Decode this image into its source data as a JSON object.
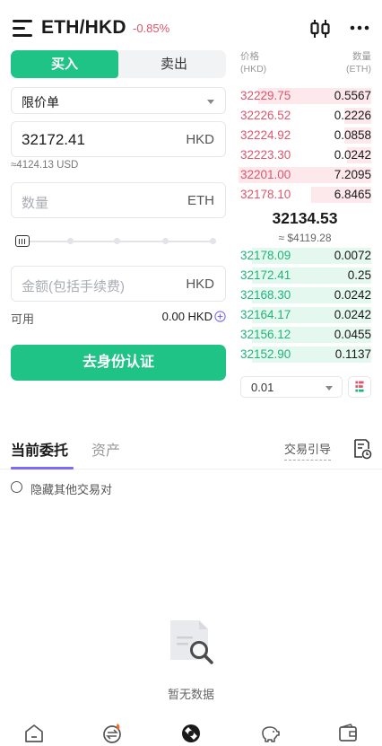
{
  "header": {
    "pair": "ETH/HKD",
    "change": "-0.85%",
    "icons": {
      "menu": "menu-icon",
      "chart": "candlestick-icon",
      "more": "more-icon"
    }
  },
  "trade_tabs": {
    "buy": "买入",
    "sell": "卖出"
  },
  "form": {
    "order_type": "限价单",
    "price_value": "32172.41",
    "price_unit": "HKD",
    "price_usd": "≈4124.13 USD",
    "qty_placeholder": "数量",
    "qty_unit": "ETH",
    "amount_placeholder": "金额(包括手续费)",
    "amount_unit": "HKD",
    "available_label": "可用",
    "available_value": "0.00 HKD",
    "slider_percent": 0,
    "submit": "去身份认证"
  },
  "orderbook": {
    "price_header": "价格",
    "price_header_unit": "(HKD)",
    "qty_header": "数量",
    "qty_header_unit": "(ETH)",
    "asks": [
      {
        "price": "32229.75",
        "qty": "0.5567",
        "depth": 0.85
      },
      {
        "price": "32226.52",
        "qty": "0.2226",
        "depth": 0.2
      },
      {
        "price": "32224.92",
        "qty": "0.0858",
        "depth": 0.2
      },
      {
        "price": "32223.30",
        "qty": "0.0242",
        "depth": 0.18
      },
      {
        "price": "32201.00",
        "qty": "7.2095",
        "depth": 1.0
      },
      {
        "price": "32178.10",
        "qty": "6.8465",
        "depth": 0.45
      }
    ],
    "last_price": "32134.53",
    "last_price_usd": "≈ $4119.28",
    "bids": [
      {
        "price": "32178.09",
        "qty": "0.0072",
        "depth": 0.9
      },
      {
        "price": "32172.41",
        "qty": "0.25",
        "depth": 0.9
      },
      {
        "price": "32168.30",
        "qty": "0.0242",
        "depth": 0.9
      },
      {
        "price": "32164.17",
        "qty": "0.0242",
        "depth": 0.9
      },
      {
        "price": "32156.12",
        "qty": "0.0455",
        "depth": 0.9
      },
      {
        "price": "32152.90",
        "qty": "0.1137",
        "depth": 0.9
      }
    ],
    "precision": "0.01",
    "colors": {
      "ask": "#e0546b",
      "bid": "#20b47a",
      "accent": "#20c386"
    }
  },
  "orders": {
    "tab_current": "当前委托",
    "tab_assets": "资产",
    "guide": "交易引导",
    "hide_pairs": "隐藏其他交易对",
    "empty": "暂无数据"
  },
  "nav": {
    "items": [
      "home-icon",
      "exchange-icon",
      "trade-icon",
      "piggy-bank-icon",
      "wallet-icon"
    ]
  }
}
